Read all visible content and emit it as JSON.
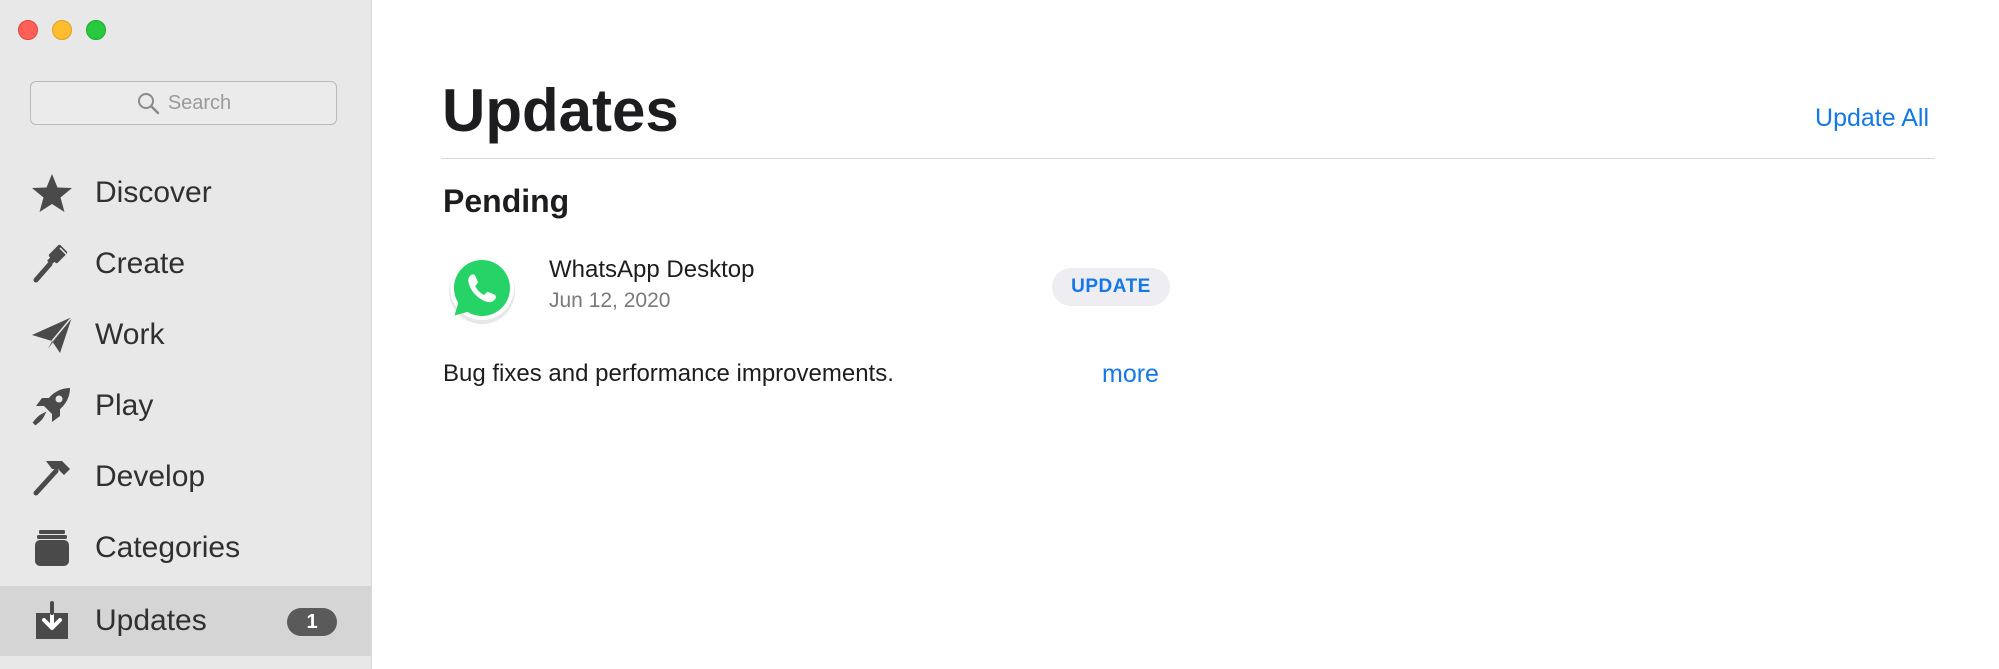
{
  "window": {
    "controls": [
      "close",
      "minimize",
      "zoom"
    ],
    "control_colors": {
      "close": "#ff5f57",
      "minimize": "#febc2e",
      "zoom": "#28c840"
    }
  },
  "sidebar": {
    "search": {
      "placeholder": "Search",
      "icon": "search-icon"
    },
    "items": [
      {
        "label": "Discover",
        "icon": "star-icon",
        "active": false
      },
      {
        "label": "Create",
        "icon": "paintbrush-icon",
        "active": false
      },
      {
        "label": "Work",
        "icon": "paper-plane-icon",
        "active": false
      },
      {
        "label": "Play",
        "icon": "rocket-icon",
        "active": false
      },
      {
        "label": "Develop",
        "icon": "hammer-icon",
        "active": false
      },
      {
        "label": "Categories",
        "icon": "stack-icon",
        "active": false
      },
      {
        "label": "Updates",
        "icon": "download-icon",
        "active": true,
        "badge": "1"
      }
    ]
  },
  "main": {
    "title": "Updates",
    "update_all_label": "Update All",
    "sections": [
      {
        "title": "Pending",
        "apps": [
          {
            "name": "WhatsApp Desktop",
            "date": "Jun 12, 2020",
            "icon": "whatsapp-icon",
            "button_label": "UPDATE",
            "release_notes": "Bug fixes and performance improvements.",
            "more_label": "more"
          }
        ]
      }
    ]
  },
  "colors": {
    "accent": "#1478e8",
    "sidebar_bg": "#e8e8e8",
    "active_item_bg": "#d5d5d5",
    "badge_bg": "#5a5a5a",
    "whatsapp_green": "#25d366"
  }
}
